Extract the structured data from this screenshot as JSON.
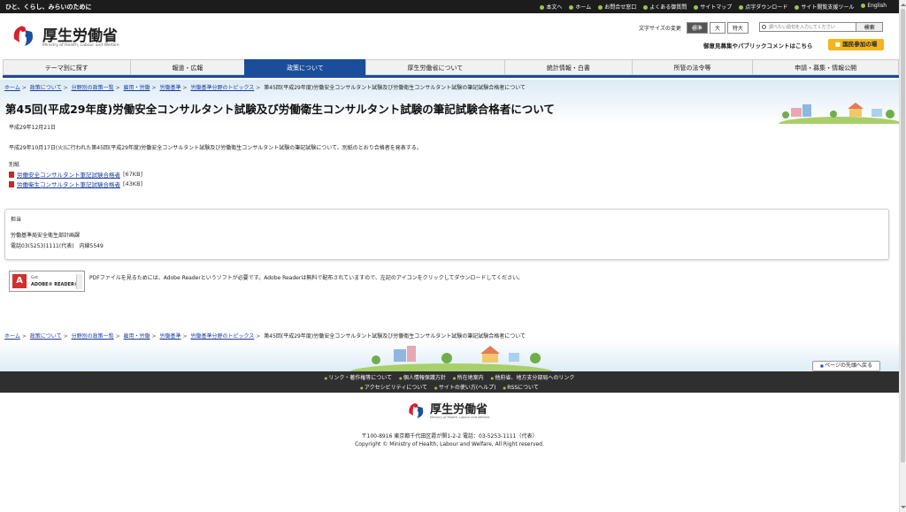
{
  "topbar": {
    "slogan": "ひと、くらし、みらいのために",
    "links": [
      "本文へ",
      "ホーム",
      "お問合せ窓口",
      "よくある御質問",
      "サイトマップ",
      "点字ダウンロード",
      "サイト閲覧支援ツール",
      "English"
    ]
  },
  "header": {
    "logo_text": "厚生労働省",
    "logo_sub": "Ministry of Health, Labour and Welfare",
    "fontsize_label": "文字サイズの変更",
    "fontsize_options": [
      "標準",
      "大",
      "特大"
    ],
    "search_placeholder": "調べたい語句を入力してください",
    "search_button": "検索",
    "opinion": "御意見募集やパブリックコメントはこちら",
    "kokumin": "国民参加の場"
  },
  "gnav": [
    "テーマ別に探す",
    "報道・広報",
    "政策について",
    "厚生労働省について",
    "統計情報・白書",
    "所管の法令等",
    "申請・募集・情報公開"
  ],
  "breadcrumb": {
    "items": [
      "ホーム",
      "政策について",
      "分野別の政策一覧",
      "雇用・労働",
      "労働基準",
      "労働基準分野のトピックス"
    ],
    "current": "第45回(平成29年度)労働安全コンサルタント試験及び労働衛生コンサルタント試験の筆記試験合格者について"
  },
  "main": {
    "title": "第45回(平成29年度)労働安全コンサルタント試験及び労働衛生コンサルタント試験の筆記試験合格者について",
    "date": "平成29年12月21日",
    "lead": "平成29年10月17日(火)に行われた第45回(平成29年度)労働安全コンサルタント試験及び労働衛生コンサルタント試験の筆記試験について、別紙のとおり合格者を発表する。",
    "attachments_label": "別紙",
    "attachments": [
      {
        "label": "労働安全コンサルタント筆記試験合格者",
        "size": "[67KB]"
      },
      {
        "label": "労働衛生コンサルタント筆記試験合格者",
        "size": "[43KB]"
      }
    ]
  },
  "contact": {
    "heading": "担当",
    "line1": "労働基準局安全衛生部計画課",
    "line2": "電話03(5253)1111(代表)　内線5549"
  },
  "adobe": {
    "get": "Get",
    "reader": "ADOBE® READER®",
    "text": "PDFファイルを見るためには、Adobe Readerというソフトが必要です。Adobe Readerは無料で配布されていますので、左記のアイコンをクリックしてダウンロードしてください。"
  },
  "pagetop": "ページの先頭へ戻る",
  "footer": {
    "row1": [
      "リンク・著作権等について",
      "個人情報保護方針",
      "所在地案内",
      "他府省、地方支分部局へのリンク"
    ],
    "row2": [
      "アクセシビリティについて",
      "サイトの使い方(ヘルプ)",
      "RSSについて"
    ],
    "address": "〒100-8916 東京都千代田区霞が関1-2-2 電話：03-5253-1111（代表）",
    "copyright": "Copyright © Ministry of Health, Labour and Welfare, All Right reserved."
  },
  "colors": {
    "nav_active": "#1a4d9a",
    "link": "#1a3d9c",
    "accent": "#f3b51b",
    "footer_bg": "#2f2f2f"
  }
}
